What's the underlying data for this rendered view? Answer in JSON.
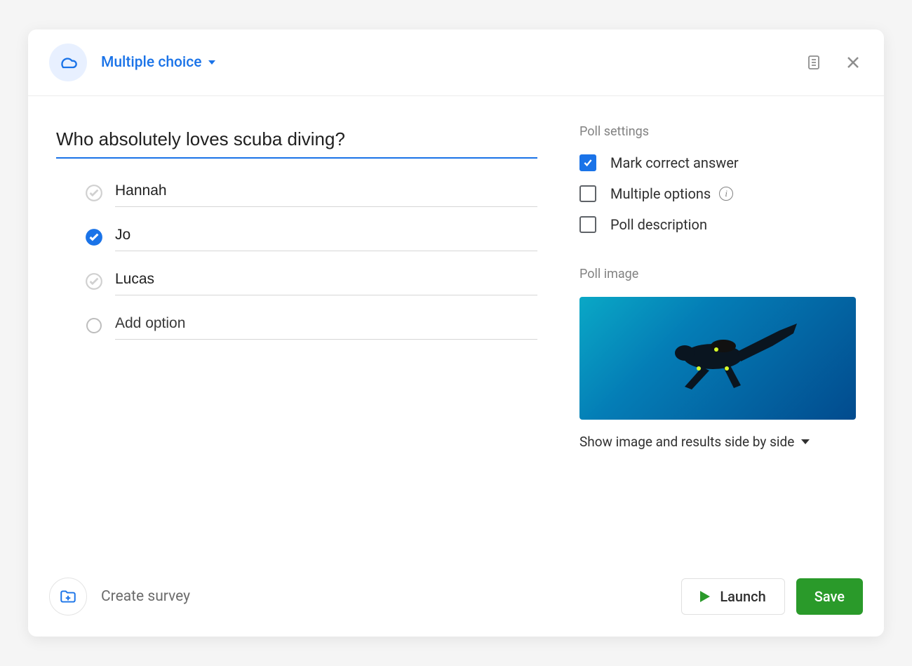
{
  "header": {
    "type_label": "Multiple choice"
  },
  "question": {
    "text": "Who absolutely loves scuba diving?"
  },
  "options": [
    {
      "text": "Hannah",
      "correct": false
    },
    {
      "text": "Jo",
      "correct": true
    },
    {
      "text": "Lucas",
      "correct": false
    }
  ],
  "add_option_label": "Add option",
  "settings": {
    "title": "Poll settings",
    "mark_correct": {
      "label": "Mark correct answer",
      "checked": true
    },
    "multiple_options": {
      "label": "Multiple options",
      "checked": false
    },
    "poll_description": {
      "label": "Poll description",
      "checked": false
    }
  },
  "image_section": {
    "title": "Poll image",
    "layout_label": "Show image and results side by side"
  },
  "footer": {
    "create_survey": "Create survey",
    "launch": "Launch",
    "save": "Save"
  }
}
